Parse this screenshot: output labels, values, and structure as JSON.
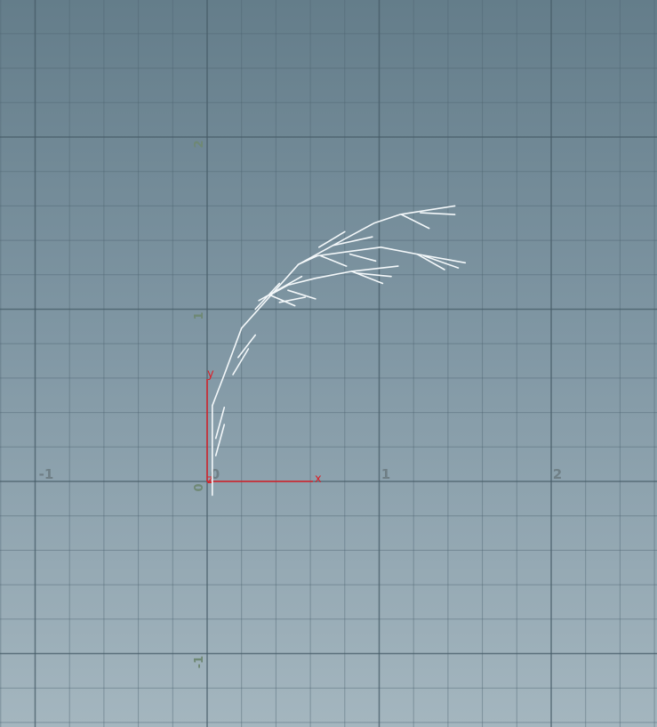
{
  "view": {
    "name": "orthographic-viewport",
    "grid_major_step": 1,
    "grid_minor_divisions": 5,
    "x_range": [
      -1.2,
      2.6
    ],
    "y_range": [
      -1.4,
      2.8
    ]
  },
  "axes": {
    "x_labels": [
      "-1",
      "0",
      "1",
      "2"
    ],
    "y_labels": [
      "2",
      "1",
      "0",
      "-1"
    ]
  },
  "origin_gizmo": {
    "x_label": "x",
    "y_label": "y",
    "z_label": "z",
    "color": "#d9222a"
  },
  "plant": {
    "color": "#f4f8fa",
    "paths": [
      [
        [
          0.03,
          -0.08
        ],
        [
          0.03,
          0.44
        ],
        [
          0.1,
          0.62
        ],
        [
          0.2,
          0.89
        ],
        [
          0.37,
          1.08
        ],
        [
          0.53,
          1.26
        ],
        [
          0.73,
          1.37
        ],
        [
          0.97,
          1.5
        ],
        [
          1.12,
          1.55
        ],
        [
          1.44,
          1.6
        ]
      ],
      [
        [
          1.13,
          1.55
        ],
        [
          1.29,
          1.47
        ]
      ],
      [
        [
          1.24,
          1.56
        ],
        [
          1.44,
          1.55
        ]
      ],
      [
        [
          0.53,
          1.26
        ],
        [
          0.64,
          1.31
        ],
        [
          1.01,
          1.36
        ],
        [
          1.22,
          1.32
        ],
        [
          1.5,
          1.27
        ]
      ],
      [
        [
          1.22,
          1.32
        ],
        [
          1.38,
          1.23
        ]
      ],
      [
        [
          1.26,
          1.31
        ],
        [
          1.46,
          1.24
        ]
      ],
      [
        [
          0.66,
          1.31
        ],
        [
          0.81,
          1.25
        ]
      ],
      [
        [
          0.83,
          1.32
        ],
        [
          0.98,
          1.28
        ]
      ],
      [
        [
          0.65,
          1.36
        ],
        [
          0.8,
          1.45
        ]
      ],
      [
        [
          0.73,
          1.37
        ],
        [
          0.96,
          1.42
        ]
      ],
      [
        [
          0.36,
          1.08
        ],
        [
          0.47,
          1.14
        ],
        [
          0.63,
          1.18
        ],
        [
          0.84,
          1.22
        ],
        [
          1.11,
          1.25
        ]
      ],
      [
        [
          0.84,
          1.22
        ],
        [
          1.02,
          1.15
        ]
      ],
      [
        [
          0.87,
          1.21
        ],
        [
          1.07,
          1.19
        ]
      ],
      [
        [
          0.37,
          1.08
        ],
        [
          0.51,
          1.02
        ]
      ],
      [
        [
          0.47,
          1.11
        ],
        [
          0.63,
          1.06
        ]
      ],
      [
        [
          0.42,
          1.04
        ],
        [
          0.57,
          1.07
        ]
      ],
      [
        [
          0.28,
          1.0
        ],
        [
          0.42,
          1.15
        ]
      ],
      [
        [
          0.3,
          1.05
        ],
        [
          0.55,
          1.19
        ]
      ],
      [
        [
          0.15,
          0.62
        ],
        [
          0.24,
          0.77
        ]
      ],
      [
        [
          0.18,
          0.72
        ],
        [
          0.28,
          0.85
        ]
      ],
      [
        [
          0.05,
          0.15
        ],
        [
          0.1,
          0.33
        ]
      ],
      [
        [
          0.05,
          0.25
        ],
        [
          0.1,
          0.43
        ]
      ]
    ]
  }
}
